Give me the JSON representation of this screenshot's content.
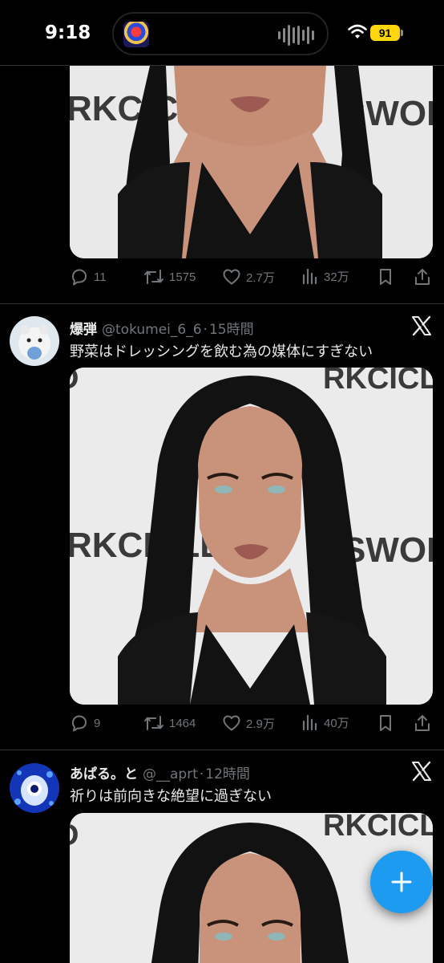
{
  "status_bar": {
    "time": "9:18",
    "battery": "91"
  },
  "tweets": [
    {
      "stats": {
        "replies": "11",
        "retweets": "1575",
        "likes": "2.7万",
        "views": "32万"
      }
    },
    {
      "name": "爆弾",
      "handle": "@tokumei_6_6",
      "separator": "·",
      "time": "15時間",
      "text": "野菜はドレッシングを飲む為の媒体にすぎない",
      "stats": {
        "replies": "9",
        "retweets": "1464",
        "likes": "2.9万",
        "views": "40万"
      }
    },
    {
      "name": "あぱる。と",
      "handle": "@__aprt",
      "separator": "·",
      "time": "12時間",
      "text": "祈りは前向きな絶望に過ぎない"
    }
  ],
  "media_backdrop_text": {
    "left": "RKCICLE.",
    "right": "SWOR"
  },
  "icons": [
    "reply-icon",
    "retweet-icon",
    "like-icon",
    "views-icon",
    "bookmark-icon",
    "share-icon",
    "x-logo-icon",
    "compose-plus-icon",
    "wifi-icon",
    "audio-wave-icon"
  ],
  "colors": {
    "accent": "#1d9bf0",
    "secondary_text": "#71767b",
    "battery": "#ffd60a"
  }
}
